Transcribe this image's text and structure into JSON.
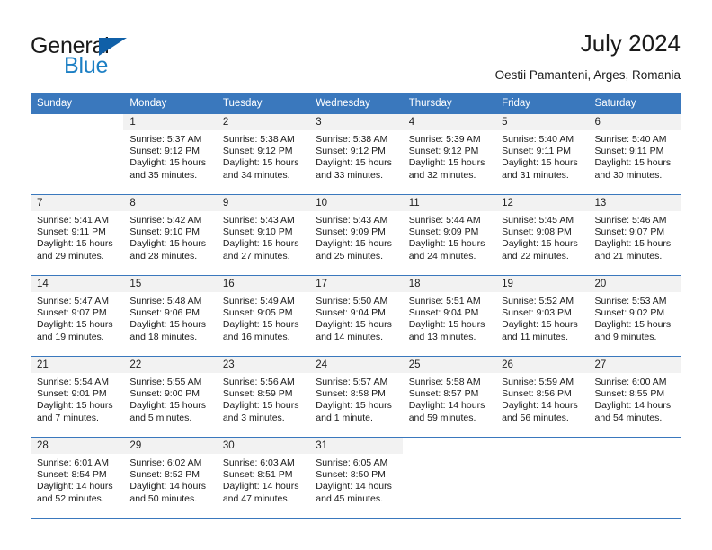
{
  "brand": {
    "name_top": "General",
    "name_bottom": "Blue",
    "triangle_color": "#1060a8",
    "blue_color": "#1c7fc4"
  },
  "header": {
    "title": "July 2024",
    "subtitle": "Oestii Pamanteni, Arges, Romania"
  },
  "theme": {
    "header_bar": "#3a78bd",
    "daynum_band": "#f2f2f2",
    "text": "#1a1a1a"
  },
  "weekday_headers": [
    "Sunday",
    "Monday",
    "Tuesday",
    "Wednesday",
    "Thursday",
    "Friday",
    "Saturday"
  ],
  "weeks": [
    [
      {
        "day": "",
        "sunrise": "",
        "sunset": "",
        "daylight": "",
        "blank": true
      },
      {
        "day": "1",
        "sunrise": "Sunrise: 5:37 AM",
        "sunset": "Sunset: 9:12 PM",
        "daylight": "Daylight: 15 hours and 35 minutes."
      },
      {
        "day": "2",
        "sunrise": "Sunrise: 5:38 AM",
        "sunset": "Sunset: 9:12 PM",
        "daylight": "Daylight: 15 hours and 34 minutes."
      },
      {
        "day": "3",
        "sunrise": "Sunrise: 5:38 AM",
        "sunset": "Sunset: 9:12 PM",
        "daylight": "Daylight: 15 hours and 33 minutes."
      },
      {
        "day": "4",
        "sunrise": "Sunrise: 5:39 AM",
        "sunset": "Sunset: 9:12 PM",
        "daylight": "Daylight: 15 hours and 32 minutes."
      },
      {
        "day": "5",
        "sunrise": "Sunrise: 5:40 AM",
        "sunset": "Sunset: 9:11 PM",
        "daylight": "Daylight: 15 hours and 31 minutes."
      },
      {
        "day": "6",
        "sunrise": "Sunrise: 5:40 AM",
        "sunset": "Sunset: 9:11 PM",
        "daylight": "Daylight: 15 hours and 30 minutes."
      }
    ],
    [
      {
        "day": "7",
        "sunrise": "Sunrise: 5:41 AM",
        "sunset": "Sunset: 9:11 PM",
        "daylight": "Daylight: 15 hours and 29 minutes."
      },
      {
        "day": "8",
        "sunrise": "Sunrise: 5:42 AM",
        "sunset": "Sunset: 9:10 PM",
        "daylight": "Daylight: 15 hours and 28 minutes."
      },
      {
        "day": "9",
        "sunrise": "Sunrise: 5:43 AM",
        "sunset": "Sunset: 9:10 PM",
        "daylight": "Daylight: 15 hours and 27 minutes."
      },
      {
        "day": "10",
        "sunrise": "Sunrise: 5:43 AM",
        "sunset": "Sunset: 9:09 PM",
        "daylight": "Daylight: 15 hours and 25 minutes."
      },
      {
        "day": "11",
        "sunrise": "Sunrise: 5:44 AM",
        "sunset": "Sunset: 9:09 PM",
        "daylight": "Daylight: 15 hours and 24 minutes."
      },
      {
        "day": "12",
        "sunrise": "Sunrise: 5:45 AM",
        "sunset": "Sunset: 9:08 PM",
        "daylight": "Daylight: 15 hours and 22 minutes."
      },
      {
        "day": "13",
        "sunrise": "Sunrise: 5:46 AM",
        "sunset": "Sunset: 9:07 PM",
        "daylight": "Daylight: 15 hours and 21 minutes."
      }
    ],
    [
      {
        "day": "14",
        "sunrise": "Sunrise: 5:47 AM",
        "sunset": "Sunset: 9:07 PM",
        "daylight": "Daylight: 15 hours and 19 minutes."
      },
      {
        "day": "15",
        "sunrise": "Sunrise: 5:48 AM",
        "sunset": "Sunset: 9:06 PM",
        "daylight": "Daylight: 15 hours and 18 minutes."
      },
      {
        "day": "16",
        "sunrise": "Sunrise: 5:49 AM",
        "sunset": "Sunset: 9:05 PM",
        "daylight": "Daylight: 15 hours and 16 minutes."
      },
      {
        "day": "17",
        "sunrise": "Sunrise: 5:50 AM",
        "sunset": "Sunset: 9:04 PM",
        "daylight": "Daylight: 15 hours and 14 minutes."
      },
      {
        "day": "18",
        "sunrise": "Sunrise: 5:51 AM",
        "sunset": "Sunset: 9:04 PM",
        "daylight": "Daylight: 15 hours and 13 minutes."
      },
      {
        "day": "19",
        "sunrise": "Sunrise: 5:52 AM",
        "sunset": "Sunset: 9:03 PM",
        "daylight": "Daylight: 15 hours and 11 minutes."
      },
      {
        "day": "20",
        "sunrise": "Sunrise: 5:53 AM",
        "sunset": "Sunset: 9:02 PM",
        "daylight": "Daylight: 15 hours and 9 minutes."
      }
    ],
    [
      {
        "day": "21",
        "sunrise": "Sunrise: 5:54 AM",
        "sunset": "Sunset: 9:01 PM",
        "daylight": "Daylight: 15 hours and 7 minutes."
      },
      {
        "day": "22",
        "sunrise": "Sunrise: 5:55 AM",
        "sunset": "Sunset: 9:00 PM",
        "daylight": "Daylight: 15 hours and 5 minutes."
      },
      {
        "day": "23",
        "sunrise": "Sunrise: 5:56 AM",
        "sunset": "Sunset: 8:59 PM",
        "daylight": "Daylight: 15 hours and 3 minutes."
      },
      {
        "day": "24",
        "sunrise": "Sunrise: 5:57 AM",
        "sunset": "Sunset: 8:58 PM",
        "daylight": "Daylight: 15 hours and 1 minute."
      },
      {
        "day": "25",
        "sunrise": "Sunrise: 5:58 AM",
        "sunset": "Sunset: 8:57 PM",
        "daylight": "Daylight: 14 hours and 59 minutes."
      },
      {
        "day": "26",
        "sunrise": "Sunrise: 5:59 AM",
        "sunset": "Sunset: 8:56 PM",
        "daylight": "Daylight: 14 hours and 56 minutes."
      },
      {
        "day": "27",
        "sunrise": "Sunrise: 6:00 AM",
        "sunset": "Sunset: 8:55 PM",
        "daylight": "Daylight: 14 hours and 54 minutes."
      }
    ],
    [
      {
        "day": "28",
        "sunrise": "Sunrise: 6:01 AM",
        "sunset": "Sunset: 8:54 PM",
        "daylight": "Daylight: 14 hours and 52 minutes."
      },
      {
        "day": "29",
        "sunrise": "Sunrise: 6:02 AM",
        "sunset": "Sunset: 8:52 PM",
        "daylight": "Daylight: 14 hours and 50 minutes."
      },
      {
        "day": "30",
        "sunrise": "Sunrise: 6:03 AM",
        "sunset": "Sunset: 8:51 PM",
        "daylight": "Daylight: 14 hours and 47 minutes."
      },
      {
        "day": "31",
        "sunrise": "Sunrise: 6:05 AM",
        "sunset": "Sunset: 8:50 PM",
        "daylight": "Daylight: 14 hours and 45 minutes."
      },
      {
        "day": "",
        "sunrise": "",
        "sunset": "",
        "daylight": "",
        "blank": true
      },
      {
        "day": "",
        "sunrise": "",
        "sunset": "",
        "daylight": "",
        "blank": true
      },
      {
        "day": "",
        "sunrise": "",
        "sunset": "",
        "daylight": "",
        "blank": true
      }
    ]
  ]
}
